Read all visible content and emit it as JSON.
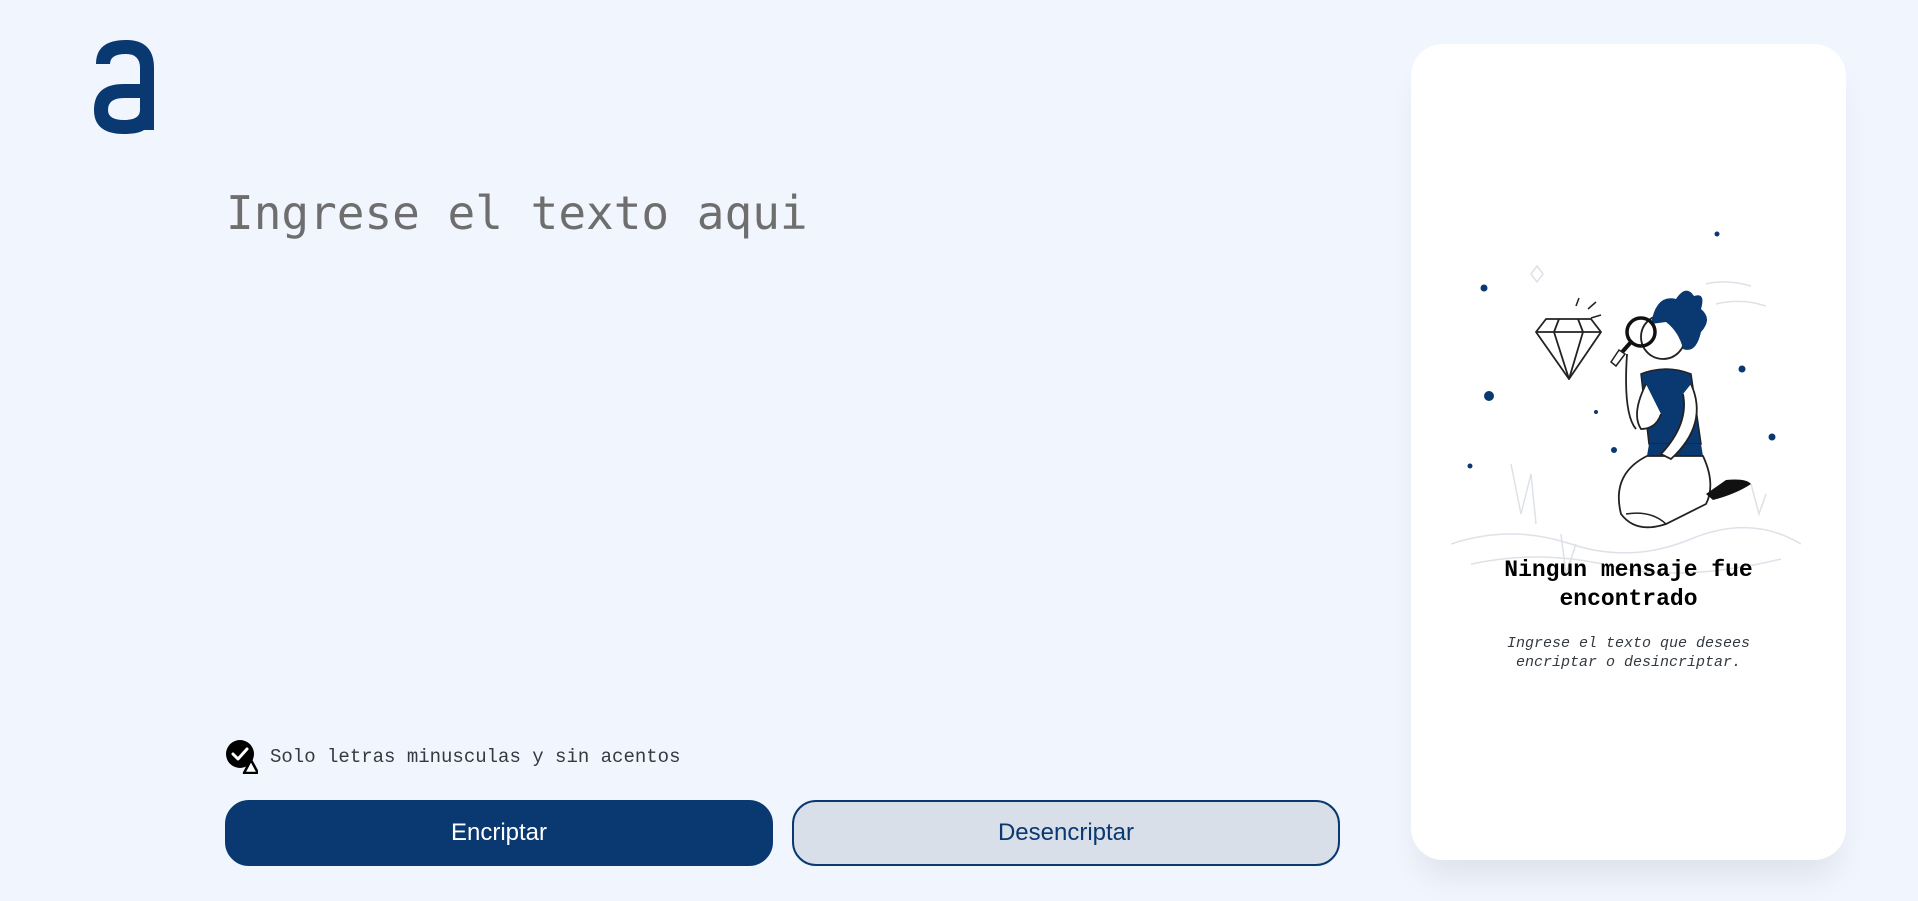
{
  "logo": {
    "letter": "a",
    "icon": "alura-logo-icon",
    "color": "#0A3871"
  },
  "input": {
    "placeholder": "Ingrese el texto aqui",
    "value": ""
  },
  "hint": {
    "icon": "check-warning-icon",
    "text": "Solo letras minusculas y sin acentos"
  },
  "buttons": {
    "encrypt_label": "Encriptar",
    "decrypt_label": "Desencriptar"
  },
  "result_panel": {
    "illustration": "person-magnifying-glass-illustration",
    "title": "Ningun mensaje fue encontrado",
    "subtitle": "Ingrese el texto que desees encriptar o desincriptar."
  },
  "colors": {
    "background": "#F1F5FD",
    "primary": "#0A3871",
    "secondary_bg": "#D8DFE8",
    "panel": "#FFFFFF"
  }
}
